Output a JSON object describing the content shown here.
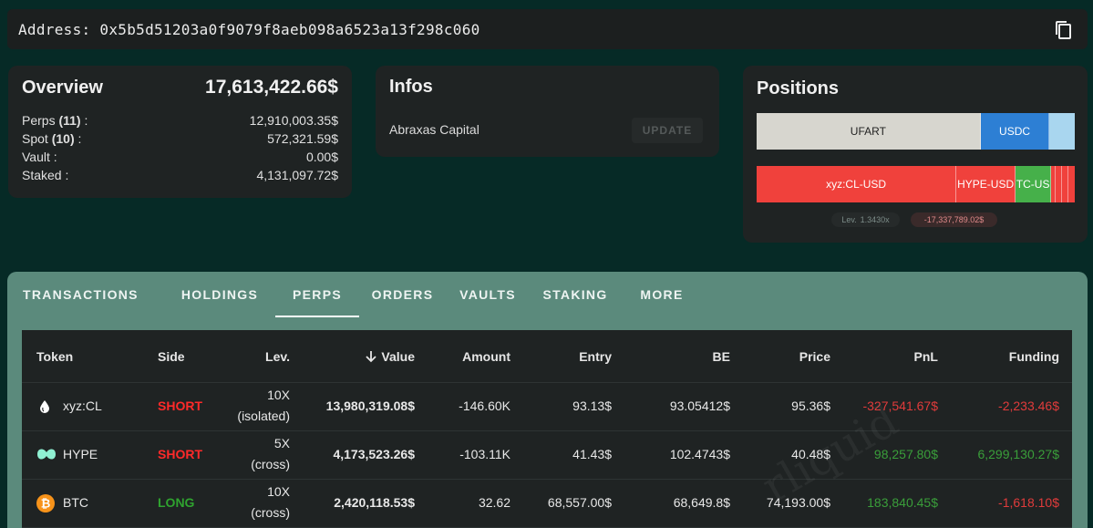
{
  "address": {
    "label": "Address:",
    "value": "0x5b5d51203a0f9079f8aeb098a6523a13f298c060"
  },
  "overview": {
    "title": "Overview",
    "total": "17,613,422.66$",
    "rows": [
      {
        "label": "Perps",
        "count": "(11)",
        "suffix": " :",
        "value": "12,910,003.35$"
      },
      {
        "label": "Spot",
        "count": "(10)",
        "suffix": " :",
        "value": "572,321.59$"
      },
      {
        "label": "Vault",
        "count": "",
        "suffix": " :",
        "value": "0.00$"
      },
      {
        "label": "Staked",
        "count": "",
        "suffix": " :",
        "value": "4,131,097.72$"
      }
    ]
  },
  "infos": {
    "title": "Infos",
    "name": "Abraxas Capital",
    "update_label": "UPDATE"
  },
  "positions": {
    "title": "Positions",
    "spot_bar": [
      {
        "label": "UFART",
        "share": 0.704,
        "color": "#d7d6cf",
        "text": "#222222"
      },
      {
        "label": "USDC",
        "share": 0.217,
        "color": "#2d7fd4",
        "text": "#ffffff"
      },
      {
        "label": "",
        "share": 0.079,
        "color": "#a9d6ef",
        "text": "#222222"
      }
    ],
    "perp_bar": [
      {
        "label": "xyz:CL-USD",
        "share": 0.628,
        "color": "#f0413c",
        "text": "#ffffff"
      },
      {
        "label": "HYPE-USD",
        "share": 0.186,
        "color": "#f0413c",
        "text": "#ffffff"
      },
      {
        "label": "TC-US",
        "share": 0.112,
        "color": "#46b04a",
        "text": "#ffffff"
      },
      {
        "label": "",
        "share": 0.014,
        "color": "#f0413c",
        "text": "#ffffff"
      },
      {
        "label": "",
        "share": 0.02,
        "color": "#f0413c",
        "text": "#ffffff"
      },
      {
        "label": "",
        "share": 0.02,
        "color": "#f0413c",
        "text": "#ffffff"
      },
      {
        "label": "",
        "share": 0.02,
        "color": "#f0413c",
        "text": "#ffffff"
      }
    ],
    "lev_label": "Lev.",
    "lev_value": "1.3430x",
    "pnl": "-17,337,789.02$"
  },
  "tabs": [
    {
      "label": "TRANSACTIONS",
      "active": false
    },
    {
      "label": "HOLDINGS",
      "active": false
    },
    {
      "label": "PERPS",
      "active": true
    },
    {
      "label": "ORDERS",
      "active": false
    },
    {
      "label": "VAULTS",
      "active": false
    },
    {
      "label": "STAKING",
      "active": false
    },
    {
      "label": "MORE",
      "active": false
    }
  ],
  "table": {
    "headers": {
      "token": "Token",
      "side": "Side",
      "lev": "Lev.",
      "value": "Value",
      "amount": "Amount",
      "entry": "Entry",
      "be": "BE",
      "price": "Price",
      "pnl": "PnL",
      "funding": "Funding"
    },
    "rows": [
      {
        "icon": "drop-icon",
        "token": "xyz:CL",
        "side": "SHORT",
        "lev": "10X",
        "mode": "(isolated)",
        "value": "13,980,319.08$",
        "amount": "-146.60K",
        "entry": "93.13$",
        "be": "93.05412$",
        "price": "95.36$",
        "pnl": "-327,541.67$",
        "funding": "-2,233.46$",
        "side_color": "#ff2a2a",
        "pnl_color": "#e03b3b",
        "funding_color": "#e03b3b"
      },
      {
        "icon": "hyperliquid-icon",
        "token": "HYPE",
        "side": "SHORT",
        "lev": "5X",
        "mode": "(cross)",
        "value": "4,173,523.26$",
        "amount": "-103.11K",
        "entry": "41.43$",
        "be": "102.4743$",
        "price": "40.48$",
        "pnl": "98,257.80$",
        "funding": "6,299,130.27$",
        "side_color": "#ff2a2a",
        "pnl_color": "#3a9e3a",
        "funding_color": "#3a9e3a"
      },
      {
        "icon": "bitcoin-icon",
        "token": "BTC",
        "side": "LONG",
        "lev": "10X",
        "mode": "(cross)",
        "value": "2,420,118.53$",
        "amount": "32.62",
        "entry": "68,557.00$",
        "be": "68,649.8$",
        "price": "74,193.00$",
        "pnl": "183,840.45$",
        "funding": "-1,618.10$",
        "side_color": "#2fa32f",
        "pnl_color": "#3a9e3a",
        "funding_color": "#e03b3b"
      }
    ]
  }
}
